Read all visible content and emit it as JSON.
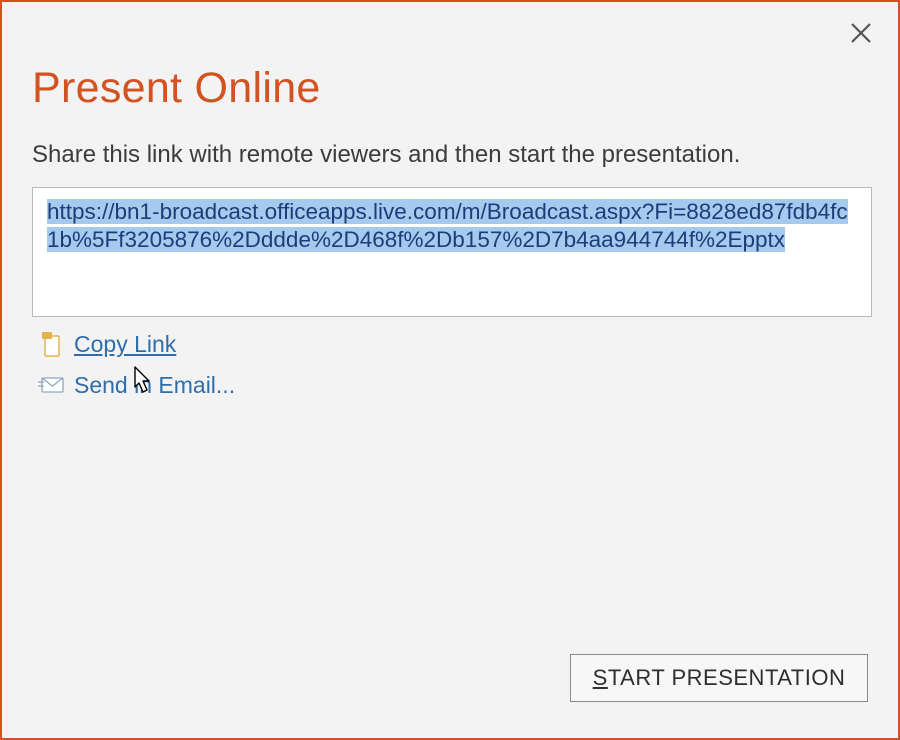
{
  "title": "Present Online",
  "subtitle": "Share this link with remote viewers and then start the presentation.",
  "share_link": "https://bn1-broadcast.officeapps.live.com/m/Broadcast.aspx?Fi=8828ed87fdb4fc1b%5Ff3205876%2Dddde%2D468f%2Db157%2D7b4aa944744f%2Epptx",
  "actions": {
    "copy_link": "Copy Link",
    "send_email": "Send in Email..."
  },
  "start_button": {
    "prefix": "S",
    "rest": "TART PRESENTATION"
  }
}
